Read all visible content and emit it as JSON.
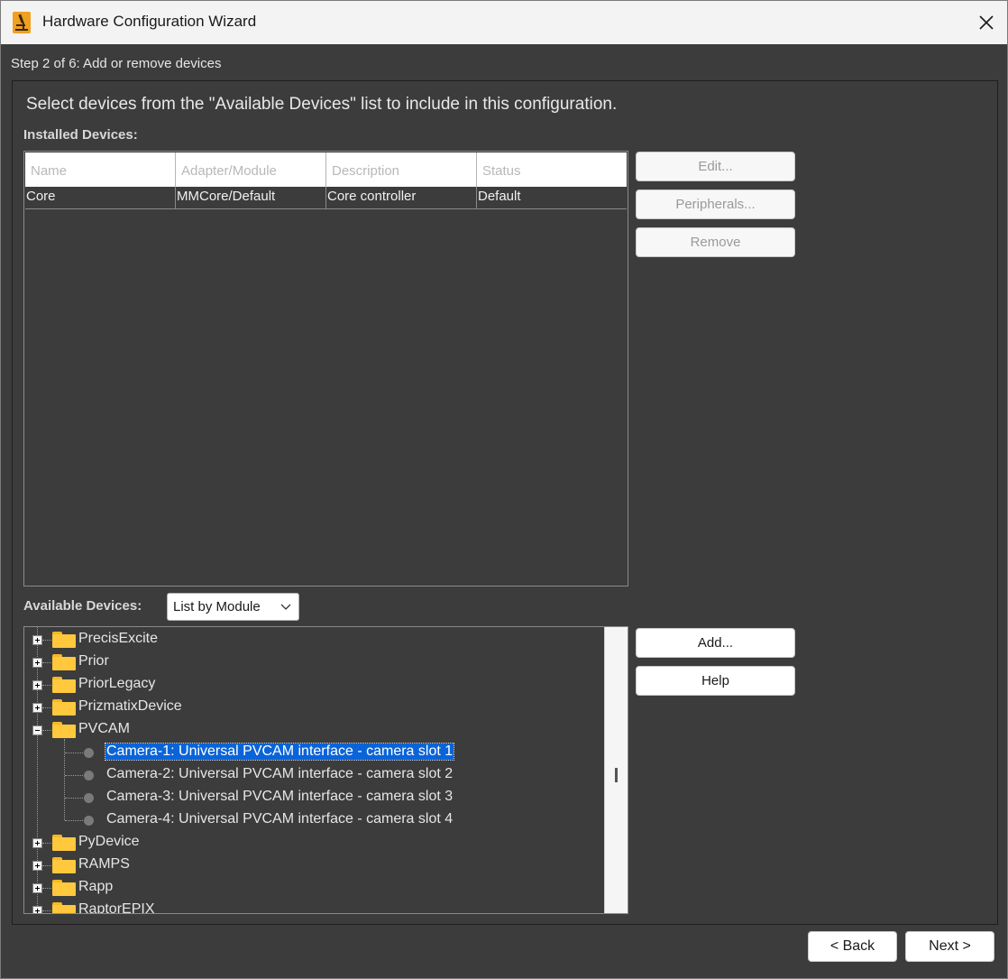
{
  "window": {
    "title": "Hardware Configuration Wizard",
    "step": "Step 2 of 6: Add or remove devices"
  },
  "instruction": "Select devices from the \"Available Devices\" list to include in this configuration.",
  "installed": {
    "label": "Installed Devices:",
    "columns": [
      "Name",
      "Adapter/Module",
      "Description",
      "Status"
    ],
    "rows": [
      [
        "Core",
        "MMCore/Default",
        "Core controller",
        "Default"
      ]
    ],
    "buttons": {
      "edit": "Edit...",
      "peripherals": "Peripherals...",
      "remove": "Remove"
    }
  },
  "available": {
    "label": "Available Devices:",
    "view_mode": "List by Module",
    "buttons": {
      "add": "Add...",
      "help": "Help"
    },
    "tree": [
      {
        "label": "PrecisExcite",
        "expanded": false
      },
      {
        "label": "Prior",
        "expanded": false
      },
      {
        "label": "PriorLegacy",
        "expanded": false
      },
      {
        "label": "PrizmatixDevice",
        "expanded": false
      },
      {
        "label": "PVCAM",
        "expanded": true,
        "children": [
          "Camera-1: Universal PVCAM interface - camera slot 1",
          "Camera-2: Universal PVCAM interface - camera slot 2",
          "Camera-3: Universal PVCAM interface - camera slot 3",
          "Camera-4: Universal PVCAM interface - camera slot 4"
        ]
      },
      {
        "label": "PyDevice",
        "expanded": false
      },
      {
        "label": "RAMPS",
        "expanded": false
      },
      {
        "label": "Rapp",
        "expanded": false
      },
      {
        "label": "RaptorEPIX",
        "expanded": false
      }
    ],
    "selected": "Camera-1: Universal PVCAM interface - camera slot 1"
  },
  "footer": {
    "back": "< Back",
    "next": "Next >"
  },
  "colors": {
    "background": "#3c3c3c",
    "selection": "#0a64d8",
    "folder": "#ffc83d"
  }
}
